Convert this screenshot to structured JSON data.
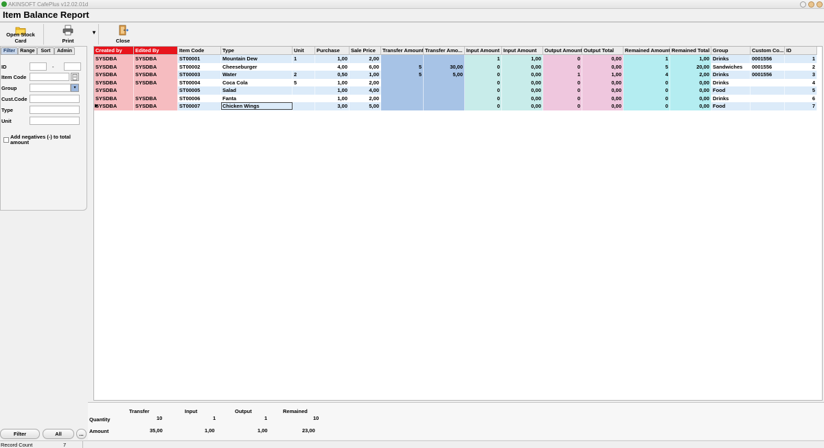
{
  "window": {
    "app_title": "AKINSOFT CafePlus v12.02.01d",
    "page_title": "Item Balance Report"
  },
  "toolbar": {
    "open_stock_card": "Open Stock Card",
    "print": "Print",
    "print_dropdown": "▼",
    "close": "Close"
  },
  "filter_panel": {
    "tabs": [
      "Filter",
      "Range",
      "Sort",
      "Admin"
    ],
    "labels": {
      "id": "ID",
      "id_sep": "-",
      "item_code": "Item Code",
      "group": "Group",
      "cust_code": "Cust.Code",
      "type": "Type",
      "unit": "Unit"
    },
    "add_negatives_label": "Add negatives (-) to total amount",
    "filter_button": "Filter",
    "all_button": "All",
    "more_button": "..."
  },
  "grid": {
    "columns": [
      "Created by",
      "Edited By",
      "Item Code",
      "Type",
      "Unit",
      "Purchase",
      "Sale Price",
      "Transfer Amount",
      "Transfer Amo...",
      "Input Amount",
      "Input Amount",
      "Output Amount",
      "Output Total",
      "Remained Amount",
      "Remained Total",
      "Group",
      "Custom Co...",
      "ID"
    ],
    "rows": [
      [
        "SYSDBA",
        "SYSDBA",
        "ST00001",
        "Mountain Dew",
        "1",
        "1,00",
        "2,00",
        "",
        "",
        "1",
        "1,00",
        "0",
        "0,00",
        "1",
        "1,00",
        "Drinks",
        "0001556",
        "1"
      ],
      [
        "SYSDBA",
        "SYSDBA",
        "ST00002",
        "Cheeseburger",
        "",
        "4,00",
        "6,00",
        "5",
        "30,00",
        "0",
        "0,00",
        "0",
        "0,00",
        "5",
        "20,00",
        "Sandwiches",
        "0001556",
        "2"
      ],
      [
        "SYSDBA",
        "SYSDBA",
        "ST00003",
        "Water",
        "2",
        "0,50",
        "1,00",
        "5",
        "5,00",
        "0",
        "0,00",
        "1",
        "1,00",
        "4",
        "2,00",
        "Drinks",
        "0001556",
        "3"
      ],
      [
        "SYSDBA",
        "SYSDBA",
        "ST00004",
        "Coca Cola",
        "5",
        "1,00",
        "2,00",
        "",
        "",
        "0",
        "0,00",
        "0",
        "0,00",
        "0",
        "0,00",
        "Drinks",
        "",
        "4"
      ],
      [
        "SYSDBA",
        "",
        "ST00005",
        "Salad",
        "",
        "1,00",
        "4,00",
        "",
        "",
        "0",
        "0,00",
        "0",
        "0,00",
        "0",
        "0,00",
        "Food",
        "",
        "5"
      ],
      [
        "SYSDBA",
        "SYSDBA",
        "ST00006",
        "Fanta",
        "",
        "1,00",
        "2,00",
        "",
        "",
        "0",
        "0,00",
        "0",
        "0,00",
        "0",
        "0,00",
        "Drinks",
        "",
        "6"
      ],
      [
        "SYSDBA",
        "SYSDBA",
        "ST00007",
        "Chicken Wings",
        "",
        "3,00",
        "5,00",
        "",
        "",
        "0",
        "0,00",
        "0",
        "0,00",
        "0",
        "0,00",
        "Food",
        "",
        "7"
      ]
    ],
    "selected_row": 6,
    "colors": {
      "red_header": "#e8141c",
      "created_bg": "#f6bcc0",
      "transfer_bg": "#a7c3e6",
      "input_bg": "#c8ecea",
      "output_bg": "#efc7de",
      "remained_bg": "#b4edf1",
      "row_even": "#ffffff",
      "row_odd": "#dcebf9"
    }
  },
  "summary": {
    "headers": [
      "Transfer",
      "Input",
      "Output",
      "Remained"
    ],
    "quantity_label": "Quantity",
    "amount_label": "Amount",
    "quantity": [
      "10",
      "1",
      "1",
      "10"
    ],
    "amount": [
      "35,00",
      "1,00",
      "1,00",
      "23,00"
    ]
  },
  "status": {
    "record_count_label": "Record Count",
    "record_count": "7"
  }
}
